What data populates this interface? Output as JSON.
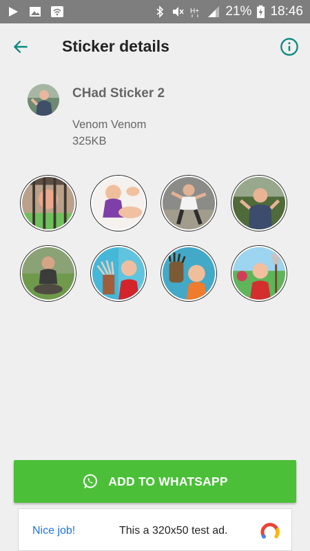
{
  "status_bar": {
    "battery_percent": "21%",
    "time": "18:46",
    "icons": [
      "play-icon",
      "image-icon",
      "wifi-icon",
      "bluetooth-icon",
      "mute-icon",
      "signal-h-plus-icon",
      "signal-bars-icon",
      "battery-charging-icon"
    ]
  },
  "toolbar": {
    "title": "Sticker details",
    "back_icon": "arrow-left-icon",
    "info_icon": "info-icon"
  },
  "pack": {
    "name": "CHad Sticker 2",
    "author": "Venom Venom",
    "size": "325KB"
  },
  "stickers": [
    {
      "name": "sticker-1",
      "scene": "prison bars"
    },
    {
      "name": "sticker-2",
      "scene": "purple shirt reaching"
    },
    {
      "name": "sticker-3",
      "scene": "action pose"
    },
    {
      "name": "sticker-4",
      "scene": "outdoor shock"
    },
    {
      "name": "sticker-5",
      "scene": "sitting on ground"
    },
    {
      "name": "sticker-6",
      "scene": "claw hand"
    },
    {
      "name": "sticker-7",
      "scene": "monster hand"
    },
    {
      "name": "sticker-8",
      "scene": "axe in garden"
    }
  ],
  "add_button": {
    "label": "ADD TO WHATSAPP",
    "icon": "whatsapp-icon",
    "color": "#4bbf38"
  },
  "ad": {
    "cta": "Nice job!",
    "text": "This a 320x50 test ad.",
    "logo": "google-ads-logo-icon"
  },
  "colors": {
    "accent": "#0b8a7e",
    "button_green": "#4bbf38",
    "status_bar": "#7e7e7e"
  }
}
